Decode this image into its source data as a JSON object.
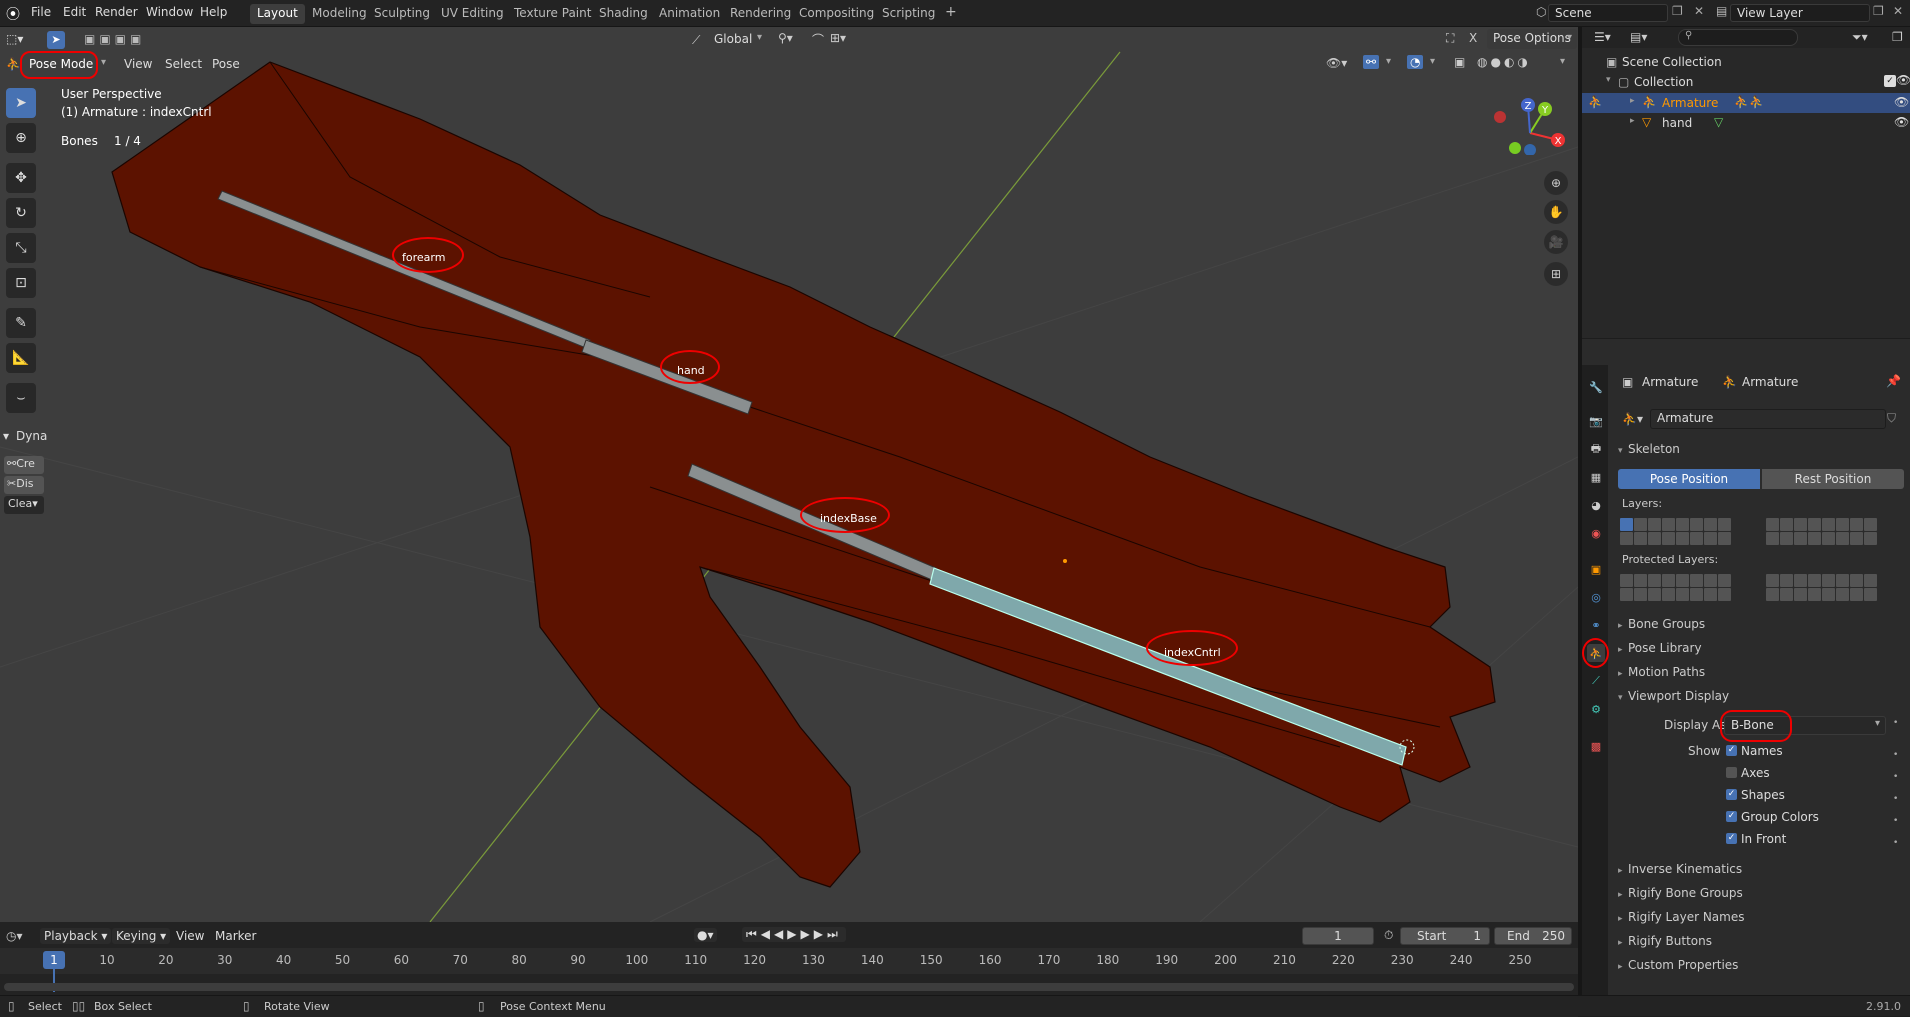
{
  "topbar": {
    "menus": [
      "File",
      "Edit",
      "Render",
      "Window",
      "Help"
    ],
    "workspaces": [
      "Layout",
      "Modeling",
      "Sculpting",
      "UV Editing",
      "Texture Paint",
      "Shading",
      "Animation",
      "Rendering",
      "Compositing",
      "Scripting"
    ],
    "active_workspace": "Layout",
    "add_tab": "+",
    "scene_name": "Scene",
    "view_layer_name": "View Layer"
  },
  "viewport_header": {
    "mode": "Pose Mode",
    "menus": [
      "View",
      "Select",
      "Pose"
    ],
    "orientation": "Global",
    "pose_options": "Pose Options"
  },
  "viewport_info": {
    "perspective": "User Perspective",
    "object": "(1) Armature : indexCntrl",
    "bones_label": "Bones",
    "bones_count": "1 / 4"
  },
  "bones": [
    "forearm",
    "hand",
    "indexBase",
    "indexCntrl"
  ],
  "gizmo": {
    "x": "X",
    "y": "Y",
    "z": "Z"
  },
  "sidebar_panel": {
    "title": "Dyna",
    "buttons": [
      "Cre",
      "Dis",
      "Clea"
    ]
  },
  "outliner": {
    "root": "Scene Collection",
    "collection": "Collection",
    "items": [
      "Armature",
      "hand"
    ]
  },
  "properties": {
    "breadcrumb_1": "Armature",
    "breadcrumb_2": "Armature",
    "datablock_name": "Armature",
    "skeleton_header": "Skeleton",
    "pose_position": "Pose Position",
    "rest_position": "Rest Position",
    "layers_label": "Layers:",
    "protected_layers_label": "Protected Layers:",
    "panels": [
      "Bone Groups",
      "Pose Library",
      "Motion Paths"
    ],
    "viewport_display": "Viewport Display",
    "display_as_label": "Display As",
    "display_as_value": "B-Bone",
    "show_label": "Show",
    "show_options": [
      {
        "label": "Names",
        "checked": true
      },
      {
        "label": "Axes",
        "checked": false
      },
      {
        "label": "Shapes",
        "checked": true
      },
      {
        "label": "Group Colors",
        "checked": true
      },
      {
        "label": "In Front",
        "checked": true
      }
    ],
    "panels_bottom": [
      "Inverse Kinematics",
      "Rigify Bone Groups",
      "Rigify Layer Names",
      "Rigify Buttons",
      "Custom Properties"
    ]
  },
  "timeline": {
    "menus": [
      "Playback",
      "Keying",
      "View",
      "Marker"
    ],
    "current_frame": "1",
    "start_label": "Start",
    "start_value": "1",
    "end_label": "End",
    "end_value": "250",
    "ruler": [
      "1",
      "10",
      "20",
      "30",
      "40",
      "50",
      "60",
      "70",
      "80",
      "90",
      "100",
      "110",
      "120",
      "130",
      "140",
      "150",
      "160",
      "170",
      "180",
      "190",
      "200",
      "210",
      "220",
      "230",
      "240",
      "250"
    ]
  },
  "statusbar": {
    "select": "Select",
    "box_select": "Box Select",
    "rotate_view": "Rotate View",
    "context_menu": "Pose Context Menu",
    "version": "2.91.0"
  },
  "colors": {
    "accent": "#4772b3",
    "mesh": "#5c1200",
    "bone": "#8a8f90",
    "bone_selected": "#7fa8ab",
    "annotation": "#e00000"
  }
}
